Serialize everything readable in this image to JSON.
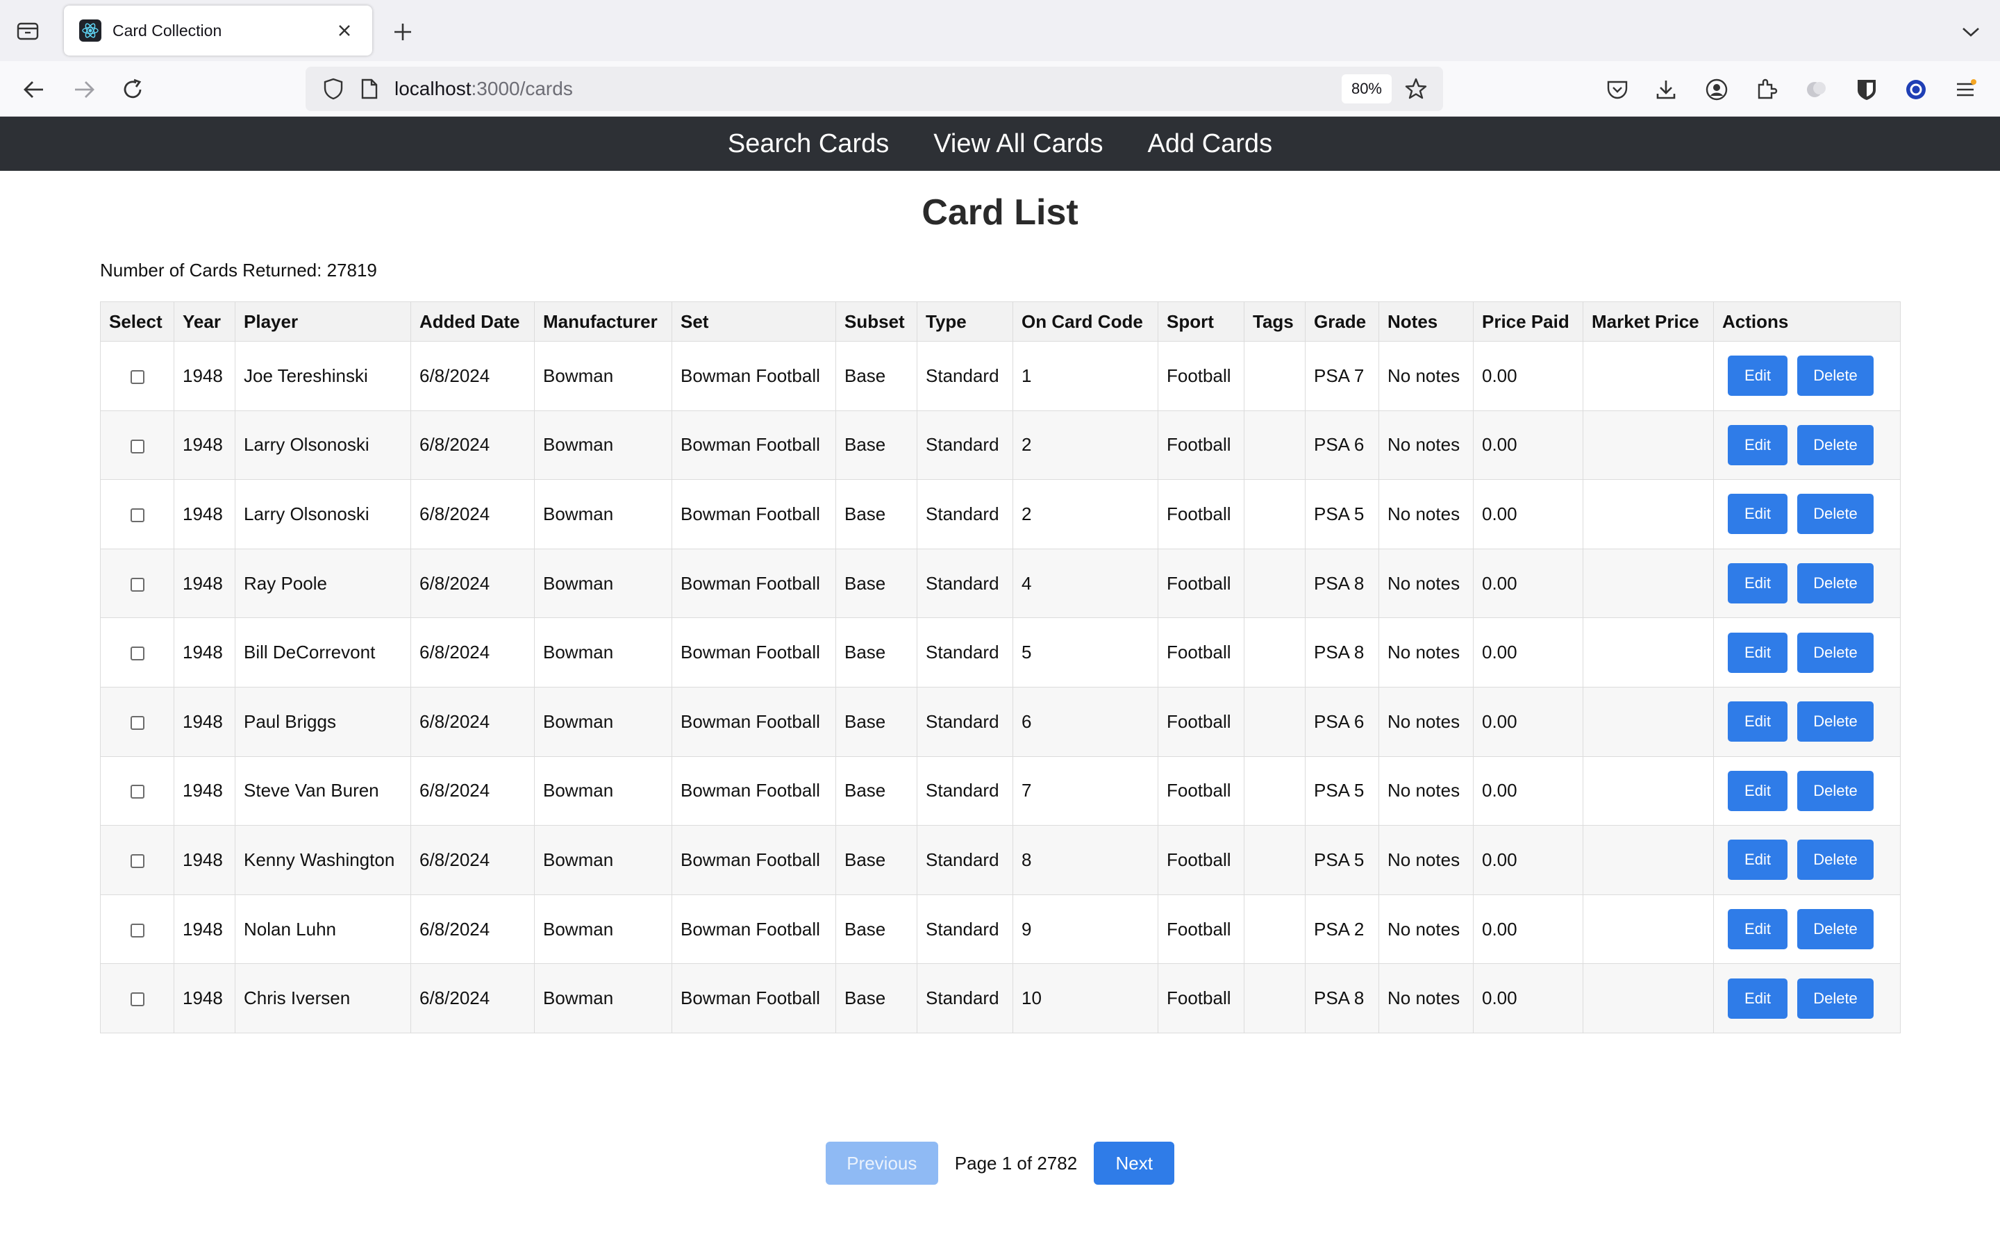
{
  "browser": {
    "tab_title": "Card Collection",
    "url_host": "localhost",
    "url_path": ":3000/cards",
    "zoom": "80%"
  },
  "nav": {
    "items": [
      "Search Cards",
      "View All Cards",
      "Add Cards"
    ]
  },
  "page": {
    "title": "Card List",
    "count_label": "Number of Cards Returned: 27819"
  },
  "table": {
    "headers": [
      "Select",
      "Year",
      "Player",
      "Added Date",
      "Manufacturer",
      "Set",
      "Subset",
      "Type",
      "On Card Code",
      "Sport",
      "Tags",
      "Grade",
      "Notes",
      "Price Paid",
      "Market Price",
      "Actions"
    ],
    "rows": [
      {
        "year": "1948",
        "player": "Joe Tereshinski",
        "added": "6/8/2024",
        "manufacturer": "Bowman",
        "set": "Bowman Football",
        "subset": "Base",
        "type": "Standard",
        "code": "1",
        "sport": "Football",
        "tags": "",
        "grade": "PSA 7",
        "notes": "No notes",
        "price_paid": "0.00",
        "market_price": ""
      },
      {
        "year": "1948",
        "player": "Larry Olsonoski",
        "added": "6/8/2024",
        "manufacturer": "Bowman",
        "set": "Bowman Football",
        "subset": "Base",
        "type": "Standard",
        "code": "2",
        "sport": "Football",
        "tags": "",
        "grade": "PSA 6",
        "notes": "No notes",
        "price_paid": "0.00",
        "market_price": ""
      },
      {
        "year": "1948",
        "player": "Larry Olsonoski",
        "added": "6/8/2024",
        "manufacturer": "Bowman",
        "set": "Bowman Football",
        "subset": "Base",
        "type": "Standard",
        "code": "2",
        "sport": "Football",
        "tags": "",
        "grade": "PSA 5",
        "notes": "No notes",
        "price_paid": "0.00",
        "market_price": ""
      },
      {
        "year": "1948",
        "player": "Ray Poole",
        "added": "6/8/2024",
        "manufacturer": "Bowman",
        "set": "Bowman Football",
        "subset": "Base",
        "type": "Standard",
        "code": "4",
        "sport": "Football",
        "tags": "",
        "grade": "PSA 8",
        "notes": "No notes",
        "price_paid": "0.00",
        "market_price": ""
      },
      {
        "year": "1948",
        "player": "Bill DeCorrevont",
        "added": "6/8/2024",
        "manufacturer": "Bowman",
        "set": "Bowman Football",
        "subset": "Base",
        "type": "Standard",
        "code": "5",
        "sport": "Football",
        "tags": "",
        "grade": "PSA 8",
        "notes": "No notes",
        "price_paid": "0.00",
        "market_price": ""
      },
      {
        "year": "1948",
        "player": "Paul Briggs",
        "added": "6/8/2024",
        "manufacturer": "Bowman",
        "set": "Bowman Football",
        "subset": "Base",
        "type": "Standard",
        "code": "6",
        "sport": "Football",
        "tags": "",
        "grade": "PSA 6",
        "notes": "No notes",
        "price_paid": "0.00",
        "market_price": ""
      },
      {
        "year": "1948",
        "player": "Steve Van Buren",
        "added": "6/8/2024",
        "manufacturer": "Bowman",
        "set": "Bowman Football",
        "subset": "Base",
        "type": "Standard",
        "code": "7",
        "sport": "Football",
        "tags": "",
        "grade": "PSA 5",
        "notes": "No notes",
        "price_paid": "0.00",
        "market_price": ""
      },
      {
        "year": "1948",
        "player": "Kenny Washington",
        "added": "6/8/2024",
        "manufacturer": "Bowman",
        "set": "Bowman Football",
        "subset": "Base",
        "type": "Standard",
        "code": "8",
        "sport": "Football",
        "tags": "",
        "grade": "PSA 5",
        "notes": "No notes",
        "price_paid": "0.00",
        "market_price": ""
      },
      {
        "year": "1948",
        "player": "Nolan Luhn",
        "added": "6/8/2024",
        "manufacturer": "Bowman",
        "set": "Bowman Football",
        "subset": "Base",
        "type": "Standard",
        "code": "9",
        "sport": "Football",
        "tags": "",
        "grade": "PSA 2",
        "notes": "No notes",
        "price_paid": "0.00",
        "market_price": ""
      },
      {
        "year": "1948",
        "player": "Chris Iversen",
        "added": "6/8/2024",
        "manufacturer": "Bowman",
        "set": "Bowman Football",
        "subset": "Base",
        "type": "Standard",
        "code": "10",
        "sport": "Football",
        "tags": "",
        "grade": "PSA 8",
        "notes": "No notes",
        "price_paid": "0.00",
        "market_price": ""
      }
    ],
    "edit_label": "Edit",
    "delete_label": "Delete"
  },
  "pagination": {
    "previous_label": "Previous",
    "page_label": "Page 1 of 2782",
    "next_label": "Next"
  },
  "colors": {
    "header_bg": "#2d3035",
    "primary": "#2f7ce8",
    "primary_disabled": "#8fbaf4"
  },
  "icons": [
    "tab-list-icon",
    "react-favicon-icon",
    "close-icon",
    "plus-icon",
    "chevron-down-icon",
    "back-icon",
    "forward-icon",
    "reload-icon",
    "shield-icon",
    "page-icon",
    "star-icon",
    "pocket-icon",
    "download-icon",
    "account-icon",
    "extensions-icon",
    "extension-icon",
    "bitwarden-icon",
    "extension-circle-icon",
    "menu-icon"
  ]
}
